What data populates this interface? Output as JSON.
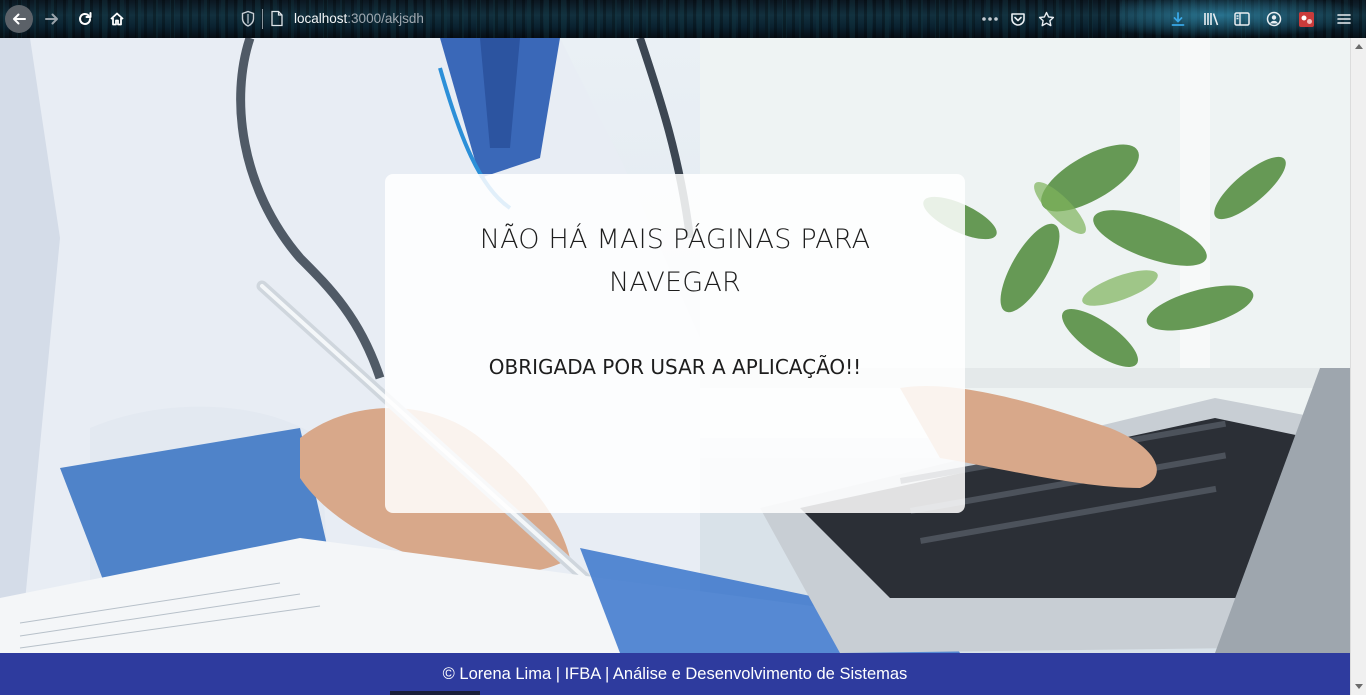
{
  "browser": {
    "url_host": "localhost",
    "url_rest": ":3000/akjsdh",
    "icons": [
      "back-arrow-icon",
      "forward-arrow-icon",
      "reload-icon",
      "home-icon",
      "shield-icon",
      "page-icon",
      "more-icon",
      "pocket-icon",
      "star-icon",
      "download-icon",
      "library-icon",
      "sidebar-icon",
      "account-icon",
      "extension-icon",
      "menu-icon"
    ]
  },
  "card": {
    "title": "NÃO HÁ MAIS PÁGINAS PARA NAVEGAR",
    "subtitle": "OBRIGADA POR USAR A APLICAÇÃO!!"
  },
  "footer": {
    "text": "© Lorena Lima | IFBA | Análise e Desenvolvimento de Sistemas"
  },
  "colors": {
    "footer_bg": "#2e3b9e",
    "card_bg": "rgba(255,255,255,0.86)",
    "download_accent": "#39a7e6"
  }
}
